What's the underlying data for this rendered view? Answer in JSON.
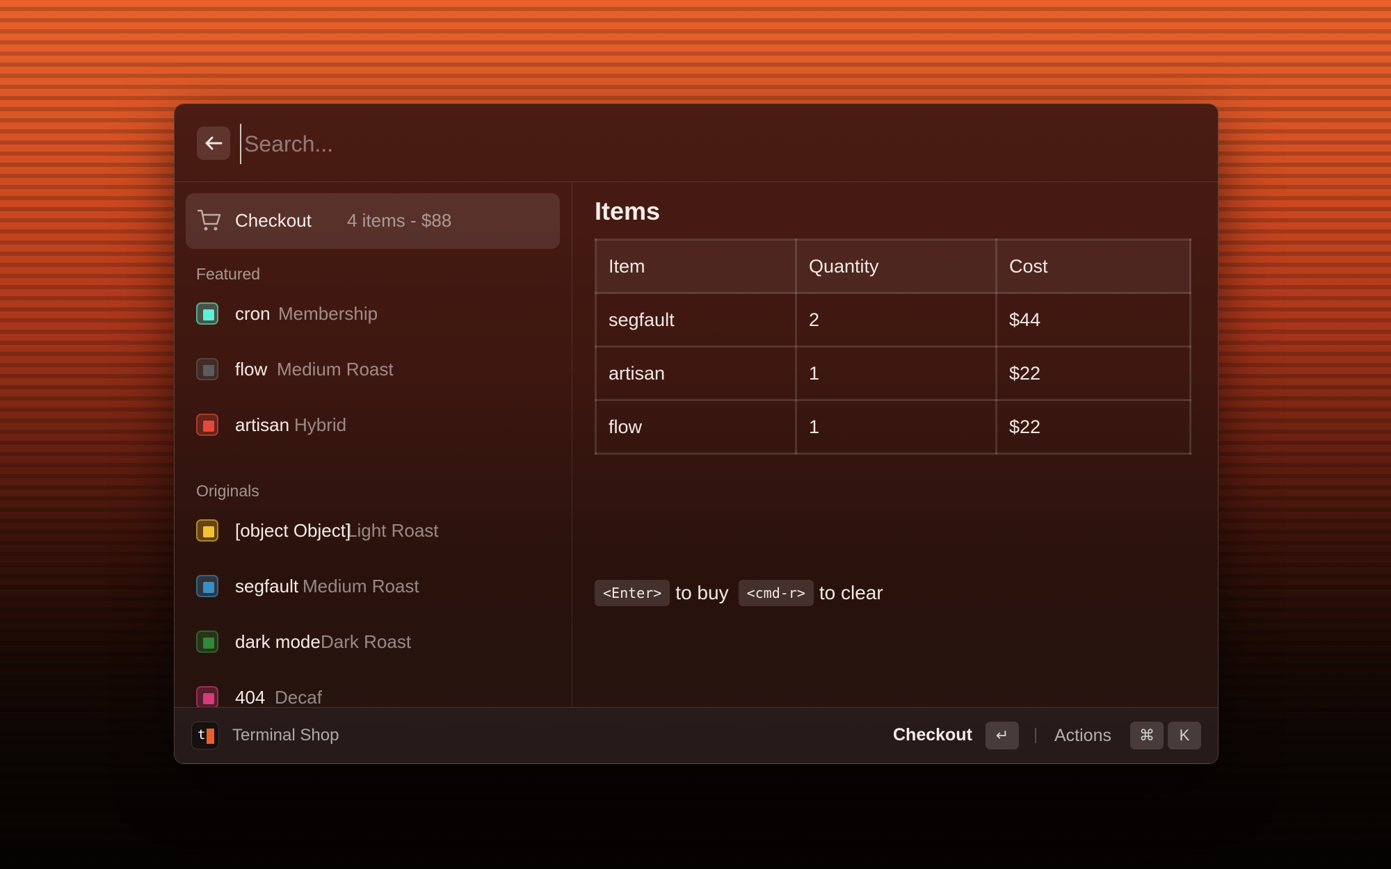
{
  "search": {
    "placeholder": "Search..."
  },
  "checkout": {
    "label": "Checkout",
    "summary": "4 items - $88"
  },
  "sections": {
    "featured": "Featured",
    "originals": "Originals"
  },
  "featured_items": [
    {
      "name": "cron",
      "type": "Membership",
      "color": "#5ef0d8"
    },
    {
      "name": "flow",
      "type": "Medium Roast",
      "color": "#5c5c5c"
    },
    {
      "name": "artisan",
      "type": "Hybrid",
      "color": "#e44a3c"
    }
  ],
  "original_items": [
    {
      "name": "[object Object]",
      "type": "Light Roast",
      "color": "#f2c230"
    },
    {
      "name": "segfault",
      "type": "Medium Roast",
      "color": "#3a8ec4"
    },
    {
      "name": "dark mode",
      "type": "Dark Roast",
      "color": "#2e8a36"
    },
    {
      "name": "404",
      "type": "Decaf",
      "color": "#d83a7a"
    }
  ],
  "detail": {
    "title": "Items",
    "columns": [
      "Item",
      "Quantity",
      "Cost"
    ],
    "rows": [
      [
        "segfault",
        "2",
        "$44"
      ],
      [
        "artisan",
        "1",
        "$22"
      ],
      [
        "flow",
        "1",
        "$22"
      ]
    ],
    "hint": {
      "buy_key": "<Enter>",
      "buy_text": "to buy",
      "clear_key": "<cmd-r>",
      "clear_text": "to clear"
    }
  },
  "footer": {
    "app_name": "Terminal Shop",
    "logo_letter": "t",
    "primary_action": "Checkout",
    "primary_key": "↵",
    "secondary_action": "Actions",
    "secondary_keys": [
      "⌘",
      "K"
    ]
  }
}
